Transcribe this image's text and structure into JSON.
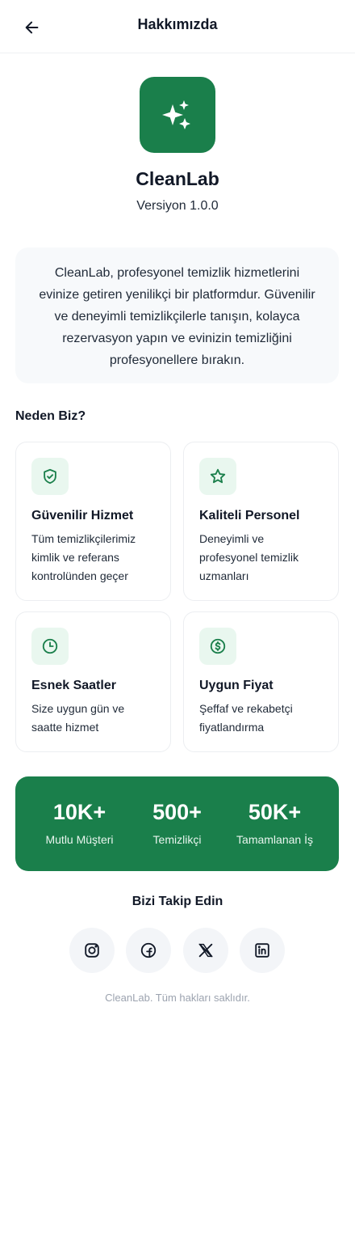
{
  "header": {
    "title": "Hakkımızda",
    "back_icon": "arrow-left-icon"
  },
  "app": {
    "logo_icon": "sparkles-icon",
    "name": "CleanLab",
    "version": "Versiyon 1.0.0"
  },
  "description": {
    "lines": [
      "CleanLab, profesyonel temizlik hizmetlerini",
      "evinize getiren yenilikçi bir platformdur. Güvenilir",
      "ve deneyimli temizlikçilerle tanışın, kolayca",
      "rezervasyon yapın ve evinizin temizliğini",
      "profesyonellere bırakın."
    ]
  },
  "why": {
    "title": "Neden Biz?",
    "features": [
      {
        "icon": "shield-check-icon",
        "title": "Güvenilir Hizmet",
        "lines": [
          "Tüm temizlikçilerimiz",
          "kimlik ve referans",
          "kontrolünden geçer"
        ]
      },
      {
        "icon": "star-icon",
        "title": "Kaliteli Personel",
        "lines": [
          "Deneyimli ve",
          "profesyonel temizlik",
          "uzmanları"
        ]
      },
      {
        "icon": "clock-icon",
        "title": "Esnek Saatler",
        "lines": [
          "Size uygun gün ve",
          "saatte hizmet"
        ]
      },
      {
        "icon": "dollar-circle-icon",
        "title": "Uygun Fiyat",
        "lines": [
          "Şeffaf ve rekabetçi",
          "fiyatlandırma"
        ]
      }
    ]
  },
  "stats": [
    {
      "value": "10K+",
      "label": "Mutlu Müşteri"
    },
    {
      "value": "500+",
      "label": "Temizlikçi"
    },
    {
      "value": "50K+",
      "label": "Tamamlanan İş"
    }
  ],
  "follow": {
    "title": "Bizi Takip Edin",
    "socials": [
      "instagram-icon",
      "facebook-icon",
      "x-icon",
      "linkedin-icon"
    ]
  },
  "footer": {
    "copyright": "CleanLab. Tüm hakları saklıdır."
  },
  "colors": {
    "brand": "#1a7f4b",
    "brand_light": "#e9f7ef",
    "card_bg": "#f7f9fb",
    "muted_text": "#9ca3af"
  }
}
